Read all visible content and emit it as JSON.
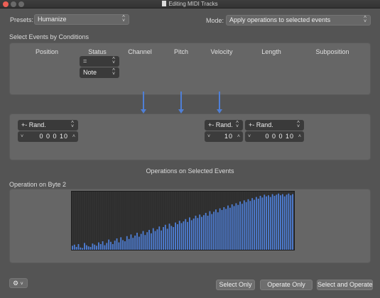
{
  "window": {
    "title": "Editing MIDI Tracks"
  },
  "presets": {
    "label": "Presets:",
    "value": "Humanize"
  },
  "mode": {
    "label": "Mode:",
    "value": "Apply operations to selected events"
  },
  "select_section": {
    "title": "Select Events by Conditions",
    "columns": [
      "Position",
      "Status",
      "Channel",
      "Pitch",
      "Velocity",
      "Length",
      "Subposition"
    ],
    "status_condition": "=",
    "status_value": "Note"
  },
  "operations": {
    "title": "Operations on Selected Events",
    "position": {
      "operator": "+- Rand.",
      "value": "0 0 0   10"
    },
    "velocity": {
      "operator": "+- Rand.",
      "value": "10"
    },
    "length": {
      "operator": "+- Rand.",
      "value": "0 0 0   10"
    }
  },
  "byte2": {
    "title": "Operation on Byte 2",
    "levels": [
      0.07,
      0.09,
      0.05,
      0.1,
      0.04,
      0.03,
      0.12,
      0.08,
      0.06,
      0.05,
      0.11,
      0.09,
      0.07,
      0.13,
      0.1,
      0.15,
      0.08,
      0.12,
      0.18,
      0.14,
      0.1,
      0.16,
      0.2,
      0.13,
      0.22,
      0.17,
      0.15,
      0.24,
      0.19,
      0.27,
      0.21,
      0.25,
      0.3,
      0.23,
      0.28,
      0.33,
      0.26,
      0.31,
      0.35,
      0.29,
      0.38,
      0.33,
      0.36,
      0.41,
      0.34,
      0.4,
      0.44,
      0.37,
      0.46,
      0.42,
      0.4,
      0.48,
      0.45,
      0.51,
      0.47,
      0.5,
      0.54,
      0.49,
      0.57,
      0.52,
      0.55,
      0.6,
      0.56,
      0.62,
      0.58,
      0.61,
      0.65,
      0.6,
      0.68,
      0.63,
      0.67,
      0.71,
      0.66,
      0.73,
      0.7,
      0.75,
      0.72,
      0.78,
      0.74,
      0.8,
      0.77,
      0.82,
      0.79,
      0.85,
      0.81,
      0.87,
      0.84,
      0.89,
      0.86,
      0.91,
      0.88,
      0.93,
      0.9,
      0.95,
      0.92,
      0.97,
      0.94,
      0.96,
      0.93,
      0.98,
      0.95,
      0.97,
      0.99,
      0.96,
      0.98,
      0.94,
      0.97,
      0.99,
      0.96,
      0.98
    ],
    "bar_color": "#4f7fd6"
  },
  "footer": {
    "gear_icon": "gear-icon",
    "buttons": {
      "select_only": "Select Only",
      "operate_only": "Operate Only",
      "select_and_operate": "Select and Operate"
    }
  }
}
